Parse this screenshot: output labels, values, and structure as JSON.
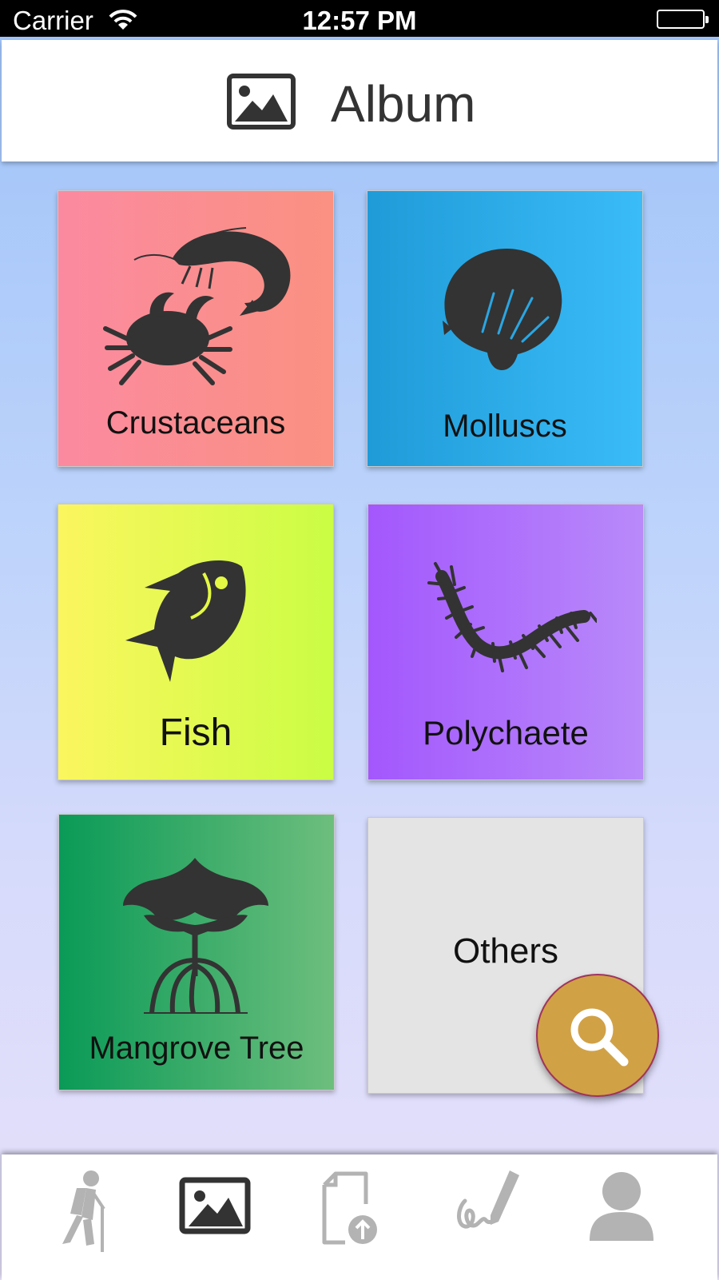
{
  "status_bar": {
    "carrier": "Carrier",
    "time": "12:57 PM"
  },
  "header": {
    "title": "Album",
    "icon": "image-icon"
  },
  "categories": [
    {
      "label": "Crustaceans",
      "icon": "shrimp-crab-icon",
      "gradient": [
        "#fb8aa0",
        "#fa9181"
      ]
    },
    {
      "label": "Molluscs",
      "icon": "shell-icon",
      "gradient": [
        "#1f9bd8",
        "#3abcf8"
      ]
    },
    {
      "label": "Fish",
      "icon": "fish-icon",
      "gradient": [
        "#fbf65e",
        "#cafd44"
      ]
    },
    {
      "label": "Polychaete",
      "icon": "worm-icon",
      "gradient": [
        "#a357fd",
        "#b98afa"
      ]
    },
    {
      "label": "Mangrove Tree",
      "icon": "mangrove-tree-icon",
      "gradient": [
        "#0a9a57",
        "#6dbe7d"
      ]
    },
    {
      "label": "Others",
      "icon": "",
      "gradient": [
        "#e4e4e4",
        "#e4e4e4"
      ]
    }
  ],
  "search_fab": {
    "icon": "search-icon",
    "color": "#d1a146"
  },
  "tab_bar": {
    "tabs": [
      {
        "icon": "hiker-icon",
        "active": false
      },
      {
        "icon": "image-icon",
        "active": true
      },
      {
        "icon": "upload-document-icon",
        "active": false
      },
      {
        "icon": "signature-pen-icon",
        "active": false
      },
      {
        "icon": "user-profile-icon",
        "active": false
      }
    ]
  },
  "colors": {
    "icon_dark": "#333333",
    "tab_inactive": "#b3b3b3",
    "text_dark": "#111111"
  }
}
